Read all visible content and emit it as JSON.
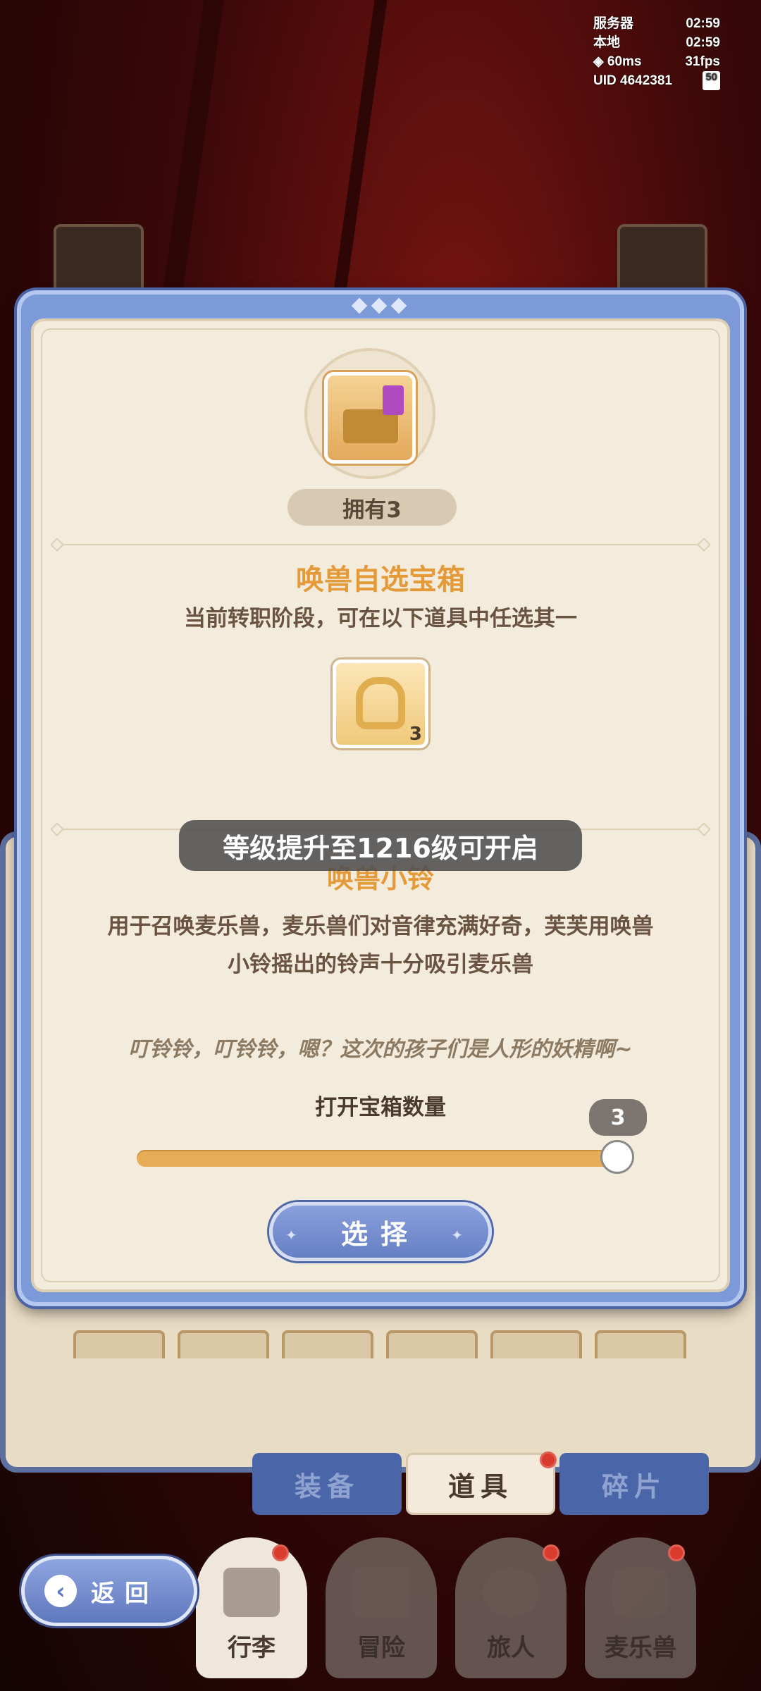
{
  "status": {
    "server_label": "服务器",
    "server_time": "02:59",
    "local_label": "本地",
    "local_time": "02:59",
    "ping": "60ms",
    "fps": "31fps",
    "uid_label": "UID",
    "uid": "4642381",
    "battery": "50"
  },
  "dialog": {
    "owned": "拥有3",
    "chest_title": "唤兽自选宝箱",
    "chest_subtitle": "当前转职阶段，可在以下道具中任选其一",
    "reward_count": "3",
    "toast": "等级提升至1216级可开启",
    "item_name": "唤兽小铃",
    "item_desc_line1": "用于召唤麦乐兽，麦乐兽们对音律充满好奇，芙芙用唤兽",
    "item_desc_line2": "小铃摇出的铃声十分吸引麦乐兽",
    "flavor": "叮铃铃，叮铃铃，嗯？这次的孩子们是人形的妖精啊~",
    "quantity_label": "打开宝箱数量",
    "quantity_value": "3",
    "quantity_fraction": 1.0,
    "select_label": "选择"
  },
  "tabs": {
    "equip": "装备",
    "items": "道具",
    "fragments": "碎片"
  },
  "nav": {
    "back": "返回",
    "bag": "行李",
    "adventure": "冒险",
    "traveler": "旅人",
    "melobeast": "麦乐兽"
  },
  "colors": {
    "accent_orange": "#e49a38",
    "modal_blue": "#7c99d8",
    "parchment": "#f3ecdd",
    "badge_red": "#d93b2c"
  }
}
